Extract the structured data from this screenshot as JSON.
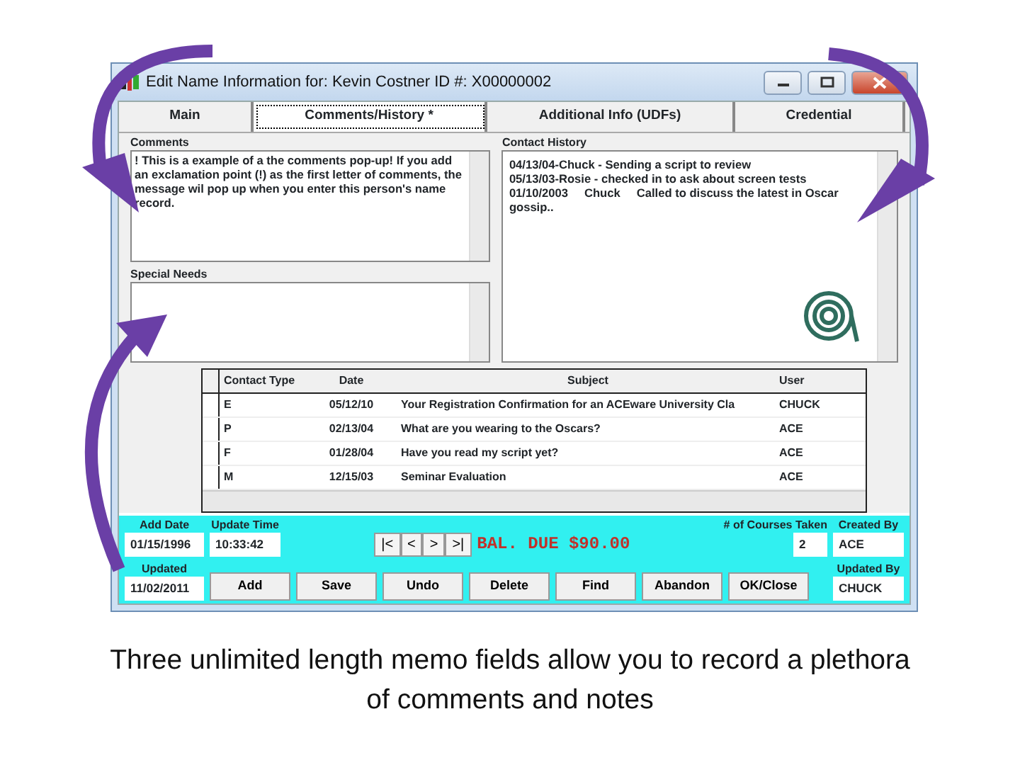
{
  "window": {
    "title": "Edit Name Information for: Kevin Costner ID #: X00000002"
  },
  "tabs": [
    {
      "label": "Main",
      "selected": false
    },
    {
      "label": "Comments/History *",
      "selected": true
    },
    {
      "label": "Additional Info (UDFs)",
      "selected": false
    },
    {
      "label": "Credential",
      "selected": false
    }
  ],
  "comments": {
    "label": "Comments",
    "value": "! This is a example of a the comments pop-up!  If you add an exclamation point (!) as the first letter of comments, the message wil pop up when you enter this person's name record."
  },
  "special_needs": {
    "label": "Special Needs"
  },
  "contact_history": {
    "label": "Contact History",
    "lines": [
      "04/13/04-Chuck - Sending a script to review",
      "05/13/03-Rosie - checked in to ask about screen tests",
      "01/10/2003     Chuck     Called to discuss the latest in Oscar gossip.."
    ]
  },
  "contacts_table": {
    "columns": [
      "Contact Type",
      "Date",
      "Subject",
      "User"
    ],
    "rows": [
      [
        "E",
        "05/12/10",
        "Your Registration Confirmation for an ACEware University Cla",
        "CHUCK"
      ],
      [
        "P",
        "02/13/04",
        "What are you wearing to the Oscars?",
        "ACE"
      ],
      [
        "F",
        "01/28/04",
        "Have you read my script yet?",
        "ACE"
      ],
      [
        "M",
        "12/15/03",
        "Seminar Evaluation",
        "ACE"
      ]
    ]
  },
  "record": {
    "add_date": {
      "label": "Add Date",
      "value": "01/15/1996"
    },
    "update_time": {
      "label": "Update Time",
      "value": "10:33:42"
    },
    "updated": {
      "label": "Updated",
      "value": "11/02/2011"
    },
    "nav_buttons": [
      "|<",
      "<",
      ">",
      ">|"
    ],
    "balance": "BAL. DUE $90.00",
    "courses_taken": {
      "label": "# of Courses Taken",
      "value": "2"
    },
    "created_by": {
      "label": "Created By",
      "value": "ACE"
    },
    "updated_by": {
      "label": "Updated By",
      "value": "CHUCK"
    }
  },
  "buttons": [
    "Add",
    "Save",
    "Undo",
    "Delete",
    "Find",
    "Abandon",
    "OK/Close"
  ],
  "caption": "Three unlimited length memo fields allow you to record a plethora of comments and notes"
}
